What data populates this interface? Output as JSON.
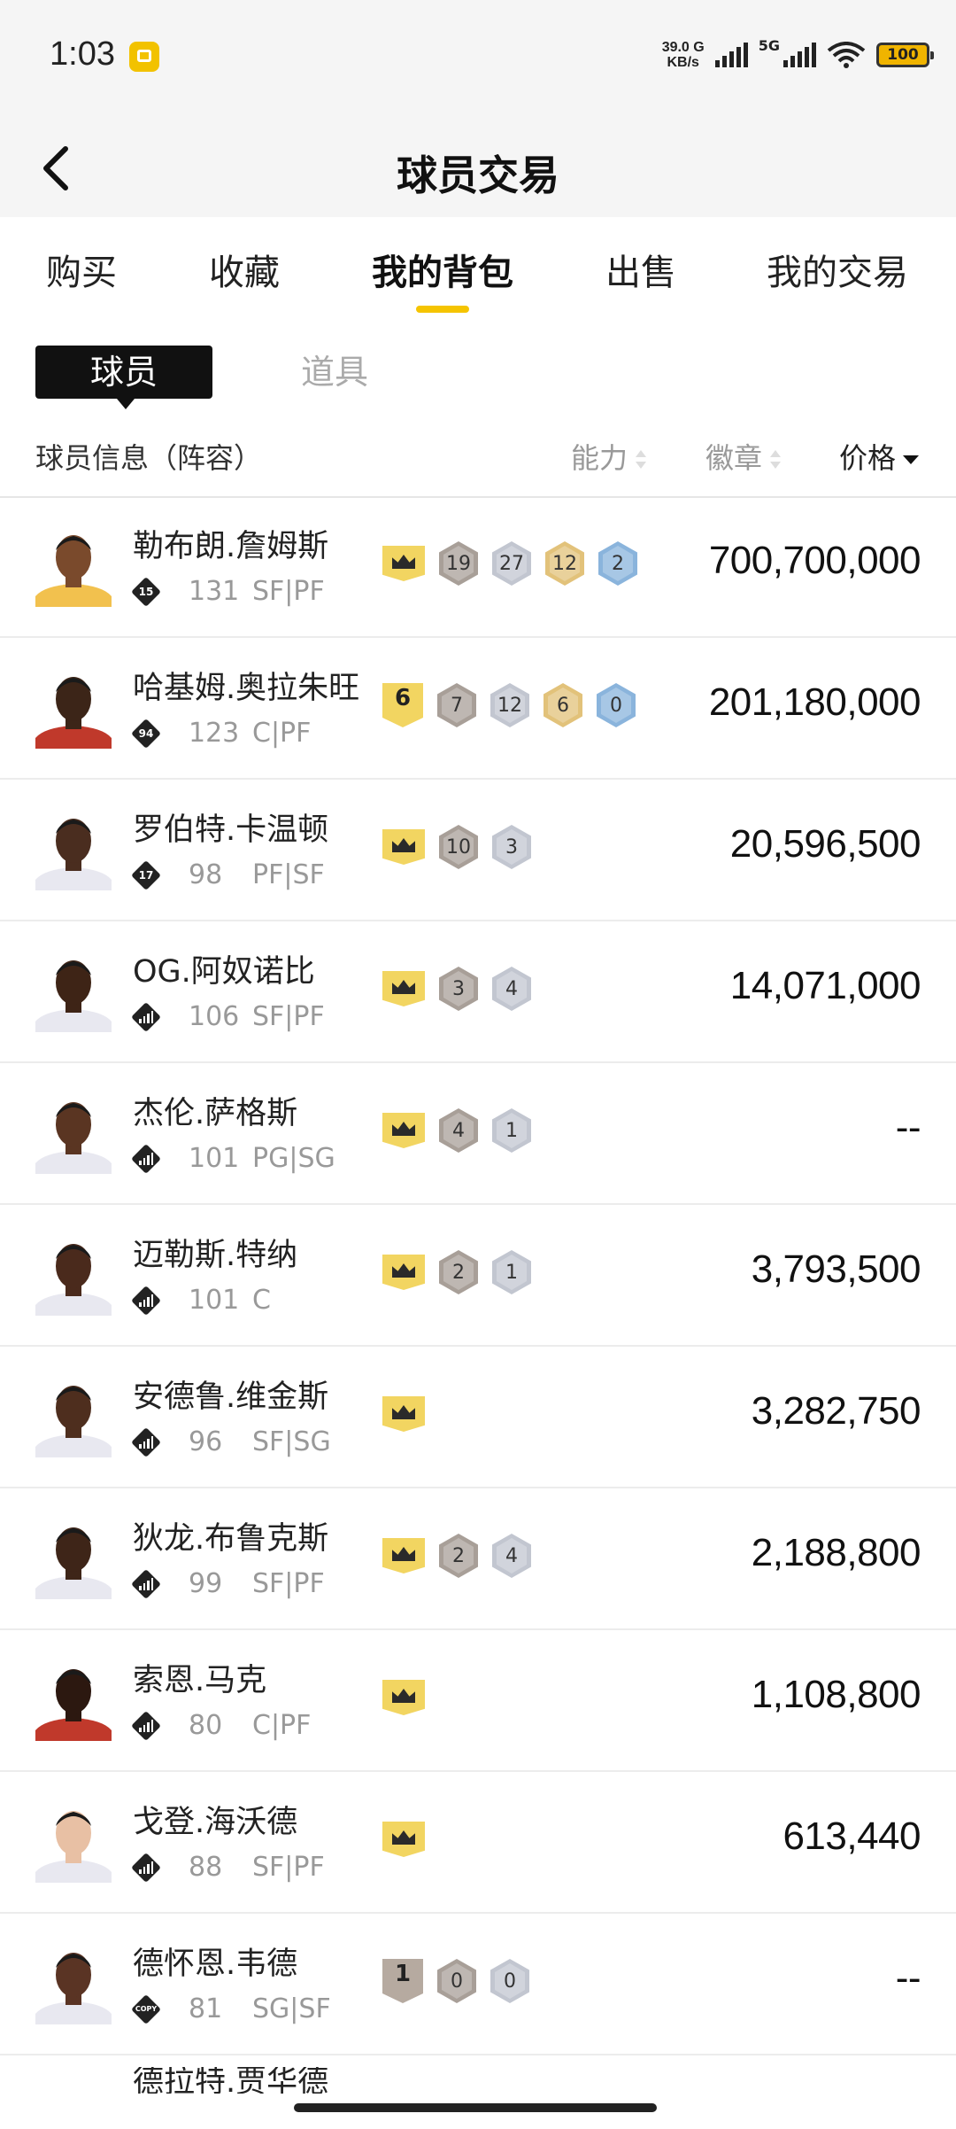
{
  "status_bar": {
    "time": "1:03",
    "net_speed_value": "39.0",
    "net_speed_suffix": "G",
    "net_speed_unit": "KB/s",
    "network_label": "5G",
    "battery": "100"
  },
  "header": {
    "title": "球员交易"
  },
  "tabs": [
    {
      "label": "购买"
    },
    {
      "label": "收藏"
    },
    {
      "label": "我的背包"
    },
    {
      "label": "出售"
    },
    {
      "label": "我的交易"
    }
  ],
  "active_tab": "我的背包",
  "subtabs": {
    "active": "球员",
    "inactive": "道具"
  },
  "columns": {
    "info": "球员信息（阵容）",
    "ability": "能力",
    "badges": "徽章",
    "price": "价格"
  },
  "colors": {
    "accent": "#f5c400",
    "crown": "#f2d561"
  },
  "players": [
    {
      "name": "勒布朗.詹姆斯",
      "rank": "15",
      "ovr": "131",
      "pos": "SF|PF",
      "level": "crown",
      "badges": [
        {
          "v": "19",
          "t": "bronze"
        },
        {
          "v": "27",
          "t": "silver"
        },
        {
          "v": "12",
          "t": "gold"
        },
        {
          "v": "2",
          "t": "blue"
        }
      ],
      "price": "700,700,000",
      "skin": "#7a4a2c",
      "jersey": "#f2c14e"
    },
    {
      "name": "哈基姆.奥拉朱旺",
      "rank": "94",
      "ovr": "123",
      "pos": "C|PF",
      "level": "6",
      "badges": [
        {
          "v": "7",
          "t": "bronze"
        },
        {
          "v": "12",
          "t": "silver"
        },
        {
          "v": "6",
          "t": "gold"
        },
        {
          "v": "0",
          "t": "blue"
        }
      ],
      "price": "201,180,000",
      "skin": "#3c2518",
      "jersey": "#c0392b"
    },
    {
      "name": "罗伯特.卡温顿",
      "rank": "17",
      "ovr": "98",
      "pos": "PF|SF",
      "level": "crown",
      "badges": [
        {
          "v": "10",
          "t": "bronze"
        },
        {
          "v": "3",
          "t": "silver"
        }
      ],
      "price": "20,596,500",
      "skin": "#4a2d1f",
      "jersey": "#e8e8f0"
    },
    {
      "name": "OG.阿奴诺比",
      "rank": "",
      "ovr": "106",
      "pos": "SF|PF",
      "level": "crown",
      "badges": [
        {
          "v": "3",
          "t": "bronze"
        },
        {
          "v": "4",
          "t": "silver"
        }
      ],
      "price": "14,071,000",
      "skin": "#3e2416",
      "jersey": "#e8e8f0"
    },
    {
      "name": "杰伦.萨格斯",
      "rank": "",
      "ovr": "101",
      "pos": "PG|SG",
      "level": "crown",
      "badges": [
        {
          "v": "4",
          "t": "bronze"
        },
        {
          "v": "1",
          "t": "silver"
        }
      ],
      "price": "--",
      "skin": "#5a3522",
      "jersey": "#e8e8f0"
    },
    {
      "name": "迈勒斯.特纳",
      "rank": "",
      "ovr": "101",
      "pos": "C",
      "level": "crown",
      "badges": [
        {
          "v": "2",
          "t": "bronze"
        },
        {
          "v": "1",
          "t": "silver"
        }
      ],
      "price": "3,793,500",
      "skin": "#4a2a1c",
      "jersey": "#e8e8f0"
    },
    {
      "name": "安德鲁.维金斯",
      "rank": "",
      "ovr": "96",
      "pos": "SF|SG",
      "level": "crown",
      "badges": [],
      "price": "3,282,750",
      "skin": "#4e2e1e",
      "jersey": "#e8e8f0"
    },
    {
      "name": "狄龙.布鲁克斯",
      "rank": "",
      "ovr": "99",
      "pos": "SF|PF",
      "level": "crown",
      "badges": [
        {
          "v": "2",
          "t": "bronze"
        },
        {
          "v": "4",
          "t": "silver"
        }
      ],
      "price": "2,188,800",
      "skin": "#3e2518",
      "jersey": "#e8e8f0"
    },
    {
      "name": "索恩.马克",
      "rank": "",
      "ovr": "80",
      "pos": "C|PF",
      "level": "crown",
      "badges": [],
      "price": "1,108,800",
      "skin": "#2c1810",
      "jersey": "#c0392b"
    },
    {
      "name": "戈登.海沃德",
      "rank": "",
      "ovr": "88",
      "pos": "SF|PF",
      "level": "crown",
      "badges": [],
      "price": "613,440",
      "skin": "#e8c0a4",
      "jersey": "#e8e8f0"
    },
    {
      "name": "德怀恩.韦德",
      "rank": "COPY",
      "ovr": "81",
      "pos": "SG|SF",
      "level": "1",
      "badges": [
        {
          "v": "0",
          "t": "bronze"
        },
        {
          "v": "0",
          "t": "silver"
        }
      ],
      "price": "--",
      "skin": "#5a3424",
      "jersey": "#e8e8f0"
    }
  ],
  "partial_row_name": "德拉特.贾华德"
}
